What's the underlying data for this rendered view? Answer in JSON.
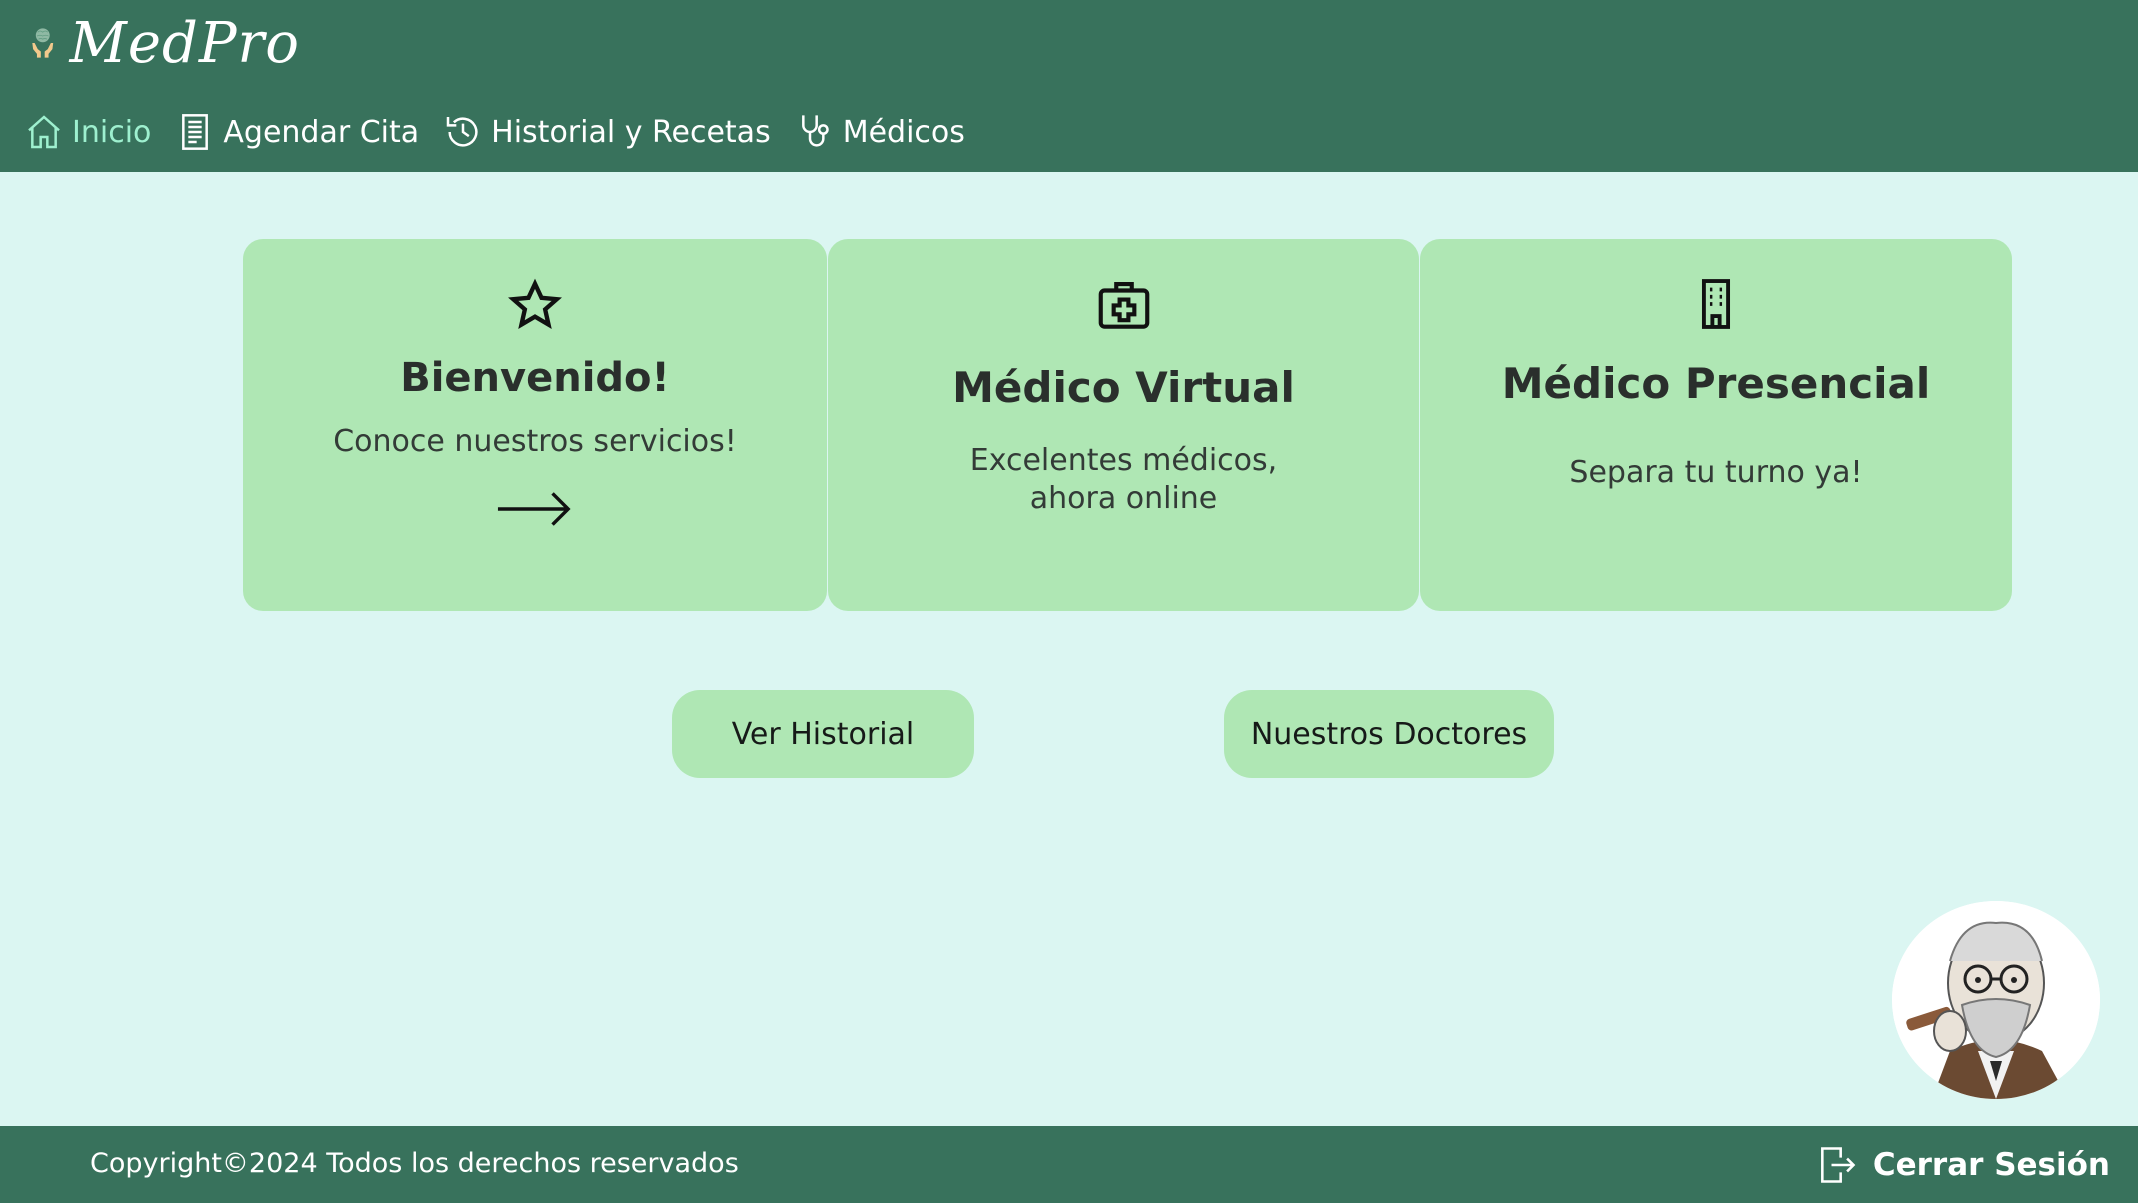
{
  "brand": {
    "name": "MedPro",
    "logo_icon": "brain-hands-icon"
  },
  "nav": {
    "items": [
      {
        "label": "Inicio",
        "icon": "home-icon",
        "active": true
      },
      {
        "label": "Agendar Cita",
        "icon": "document-icon",
        "active": false
      },
      {
        "label": "Historial y Recetas",
        "icon": "history-icon",
        "active": false
      },
      {
        "label": "Médicos",
        "icon": "stethoscope-icon",
        "active": false
      }
    ]
  },
  "cards": [
    {
      "icon": "star-icon",
      "title": "Bienvenido!",
      "text": "Conoce nuestros servicios!",
      "action_icon": "arrow-right-icon"
    },
    {
      "icon": "medical-kit-icon",
      "title": "Médico Virtual",
      "text": "Excelentes médicos, ahora online"
    },
    {
      "icon": "building-icon",
      "title": "Médico Presencial",
      "text": "Separa tu turno ya!"
    }
  ],
  "buttons": {
    "history": "Ver Historial",
    "doctors": "Nuestros Doctores"
  },
  "avatar": {
    "icon": "doctor-avatar-icon"
  },
  "footer": {
    "copyright": "Copyright©2024 Todos los derechos reservados",
    "logout": "Cerrar Sesión"
  },
  "colors": {
    "header": "#38725c",
    "background": "#dbf6f2",
    "card": "#afe7b4",
    "active_nav": "#9ef0cf"
  }
}
